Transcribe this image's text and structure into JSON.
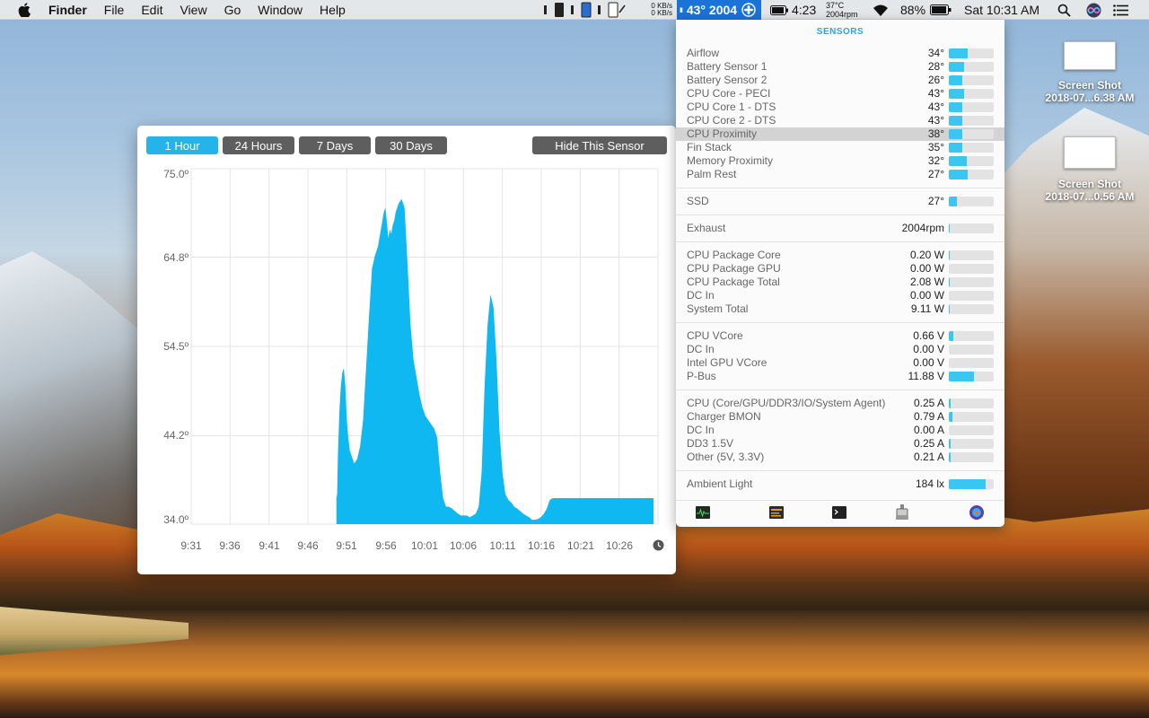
{
  "menubar": {
    "app": "Finder",
    "items": [
      "File",
      "Edit",
      "View",
      "Go",
      "Window",
      "Help"
    ],
    "net_up": "0 KB/s",
    "net_down": "0 KB/s",
    "temp_fan": "43° 2004",
    "battery_time": "4:23",
    "sensor_temp": "37°C",
    "sensor_rpm": "2004rpm",
    "battery_pct": "88%",
    "clock": "Sat 10:31 AM"
  },
  "sensors": {
    "title": "SENSORS",
    "temps": [
      {
        "label": "Airflow",
        "value": "34°",
        "fill": 0.42
      },
      {
        "label": "Battery Sensor 1",
        "value": "28°",
        "fill": 0.33
      },
      {
        "label": "Battery Sensor 2",
        "value": "26°",
        "fill": 0.3
      },
      {
        "label": "CPU Core - PECI",
        "value": "43°",
        "fill": 0.33
      },
      {
        "label": "CPU Core 1 - DTS",
        "value": "43°",
        "fill": 0.3
      },
      {
        "label": "CPU Core 2 - DTS",
        "value": "43°",
        "fill": 0.3
      },
      {
        "label": "CPU Proximity",
        "value": "38°",
        "fill": 0.3
      },
      {
        "label": "Fin Stack",
        "value": "35°",
        "fill": 0.3
      },
      {
        "label": "Memory Proximity",
        "value": "32°",
        "fill": 0.4
      },
      {
        "label": "Palm Rest",
        "value": "27°",
        "fill": 0.42
      }
    ],
    "ssd": {
      "label": "SSD",
      "value": "27°",
      "fill": 0.18
    },
    "exhaust": {
      "label": "Exhaust",
      "value": "2004rpm",
      "fill": 0.02
    },
    "power": [
      {
        "label": "CPU Package Core",
        "value": "0.20 W",
        "fill": 0.02
      },
      {
        "label": "CPU Package GPU",
        "value": "0.00 W",
        "fill": 0.0
      },
      {
        "label": "CPU Package Total",
        "value": "2.08 W",
        "fill": 0.02
      },
      {
        "label": "DC In",
        "value": "0.00 W",
        "fill": 0.0
      },
      {
        "label": "System Total",
        "value": "9.11 W",
        "fill": 0.02
      }
    ],
    "voltage": [
      {
        "label": "CPU VCore",
        "value": "0.66 V",
        "fill": 0.1
      },
      {
        "label": "DC In",
        "value": "0.00 V",
        "fill": 0.0
      },
      {
        "label": "Intel GPU VCore",
        "value": "0.00 V",
        "fill": 0.0
      },
      {
        "label": "P-Bus",
        "value": "11.88 V",
        "fill": 0.55
      }
    ],
    "current": [
      {
        "label": "CPU (Core/GPU/DDR3/IO/System Agent)",
        "value": "0.25 A",
        "fill": 0.04
      },
      {
        "label": "Charger BMON",
        "value": "0.79 A",
        "fill": 0.08
      },
      {
        "label": "DC In",
        "value": "0.00 A",
        "fill": 0.0
      },
      {
        "label": "DD3 1.5V",
        "value": "0.25 A",
        "fill": 0.04
      },
      {
        "label": "Other (5V, 3.3V)",
        "value": "0.21 A",
        "fill": 0.04
      }
    ],
    "light": {
      "label": "Ambient Light",
      "value": "184 lx",
      "fill": 0.82
    }
  },
  "chart_window": {
    "tabs": [
      "1 Hour",
      "24 Hours",
      "7 Days",
      "30 Days"
    ],
    "active_tab": "1 Hour",
    "hide_button": "Hide This Sensor"
  },
  "chart_data": {
    "type": "area",
    "title": "",
    "xlabel": "",
    "ylabel": "",
    "y_ticks": [
      "75.0º",
      "64.8º",
      "54.5º",
      "44.2º",
      "34.0º"
    ],
    "ylim": [
      34.0,
      75.0
    ],
    "x_ticks": [
      "9:31",
      "9:36",
      "9:41",
      "9:46",
      "9:51",
      "9:56",
      "10:01",
      "10:06",
      "10:11",
      "10:16",
      "10:21",
      "10:26"
    ],
    "color": "#0fb8f0",
    "series": [
      {
        "x": [
          9.8,
          9.85,
          9.9,
          10.0,
          10.1,
          10.2,
          10.3,
          10.4,
          10.5,
          10.6,
          10.7,
          10.8,
          10.9,
          11.0,
          11.2,
          11.4,
          11.6,
          11.8,
          12.0,
          12.2,
          12.4,
          12.6,
          12.8,
          13.0,
          13.1,
          13.2,
          13.3,
          13.4,
          13.5,
          13.6,
          13.7,
          13.8,
          13.9,
          14.0,
          14.2,
          14.4,
          14.6,
          14.8,
          15.0,
          15.2,
          15.4,
          15.6,
          15.8,
          16.0,
          16.2,
          16.4,
          16.6,
          16.8,
          17.0,
          17.2,
          17.4,
          17.6,
          17.8,
          18.0,
          18.2,
          18.4,
          18.6,
          18.8,
          19.0,
          19.2,
          19.4,
          19.6,
          19.8,
          20.0,
          20.2,
          20.4,
          20.6,
          20.8,
          21.0,
          21.2,
          21.4,
          21.6,
          21.8,
          22.0,
          22.2,
          22.4,
          22.6,
          22.8,
          23.0,
          23.2,
          23.4,
          23.6,
          23.8,
          24.0,
          24.2,
          24.4,
          24.6,
          24.8,
          25.0,
          25.2,
          25.4,
          25.6,
          25.8,
          26.0,
          26.2,
          26.4,
          26.6,
          26.8,
          27.0,
          27.2,
          27.4,
          27.6,
          27.8,
          28.0,
          28.2,
          28.4,
          28.6,
          28.8,
          29.0,
          29.2,
          29.4,
          29.6,
          29.8,
          30.0,
          30.2,
          30.4,
          30.6,
          30.8,
          31.0,
          31.2
        ],
        "values": [
          37.0,
          37.5,
          42.0,
          47.0,
          50.0,
          51.5,
          52.0,
          50.0,
          46.0,
          44.0,
          42.5,
          42.0,
          41.5,
          41.0,
          41.5,
          43.0,
          46.0,
          52.0,
          58.0,
          63.5,
          65.0,
          66.0,
          68.0,
          70.0,
          70.5,
          69.0,
          67.0,
          68.0,
          67.5,
          68.5,
          69.0,
          70.0,
          70.5,
          71.0,
          71.5,
          70.5,
          64.0,
          57.0,
          53.0,
          51.0,
          49.0,
          47.5,
          46.5,
          46.0,
          45.5,
          45.0,
          44.0,
          40.0,
          37.0,
          36.0,
          36.0,
          35.8,
          35.5,
          35.2,
          35.0,
          35.0,
          35.0,
          34.8,
          35.0,
          35.2,
          36.0,
          40.0,
          50.0,
          57.0,
          60.5,
          59.0,
          53.0,
          45.0,
          40.0,
          37.5,
          36.8,
          36.5,
          36.0,
          35.8,
          35.5,
          35.2,
          35.0,
          34.8,
          34.5,
          34.5,
          34.6,
          34.8,
          35.2,
          35.8,
          36.8,
          37.0,
          37.0,
          37.0,
          37.0,
          37.0,
          37.0,
          37.0,
          37.0,
          37.0,
          37.0,
          37.0,
          37.0,
          37.0,
          37.0,
          37.0,
          37.0,
          37.0,
          37.0,
          37.0,
          37.0,
          37.0,
          37.0,
          37.0,
          37.0,
          37.0,
          37.0,
          37.0,
          37.0,
          37.0,
          37.0,
          37.0,
          37.0,
          37.0,
          37.0,
          37.0
        ]
      }
    ]
  },
  "desktop": {
    "icons": [
      {
        "line1": "Screen Shot",
        "line2": "2018-07...6.38 AM"
      },
      {
        "line1": "Screen Shot",
        "line2": "2018-07...0.56 AM"
      }
    ]
  }
}
